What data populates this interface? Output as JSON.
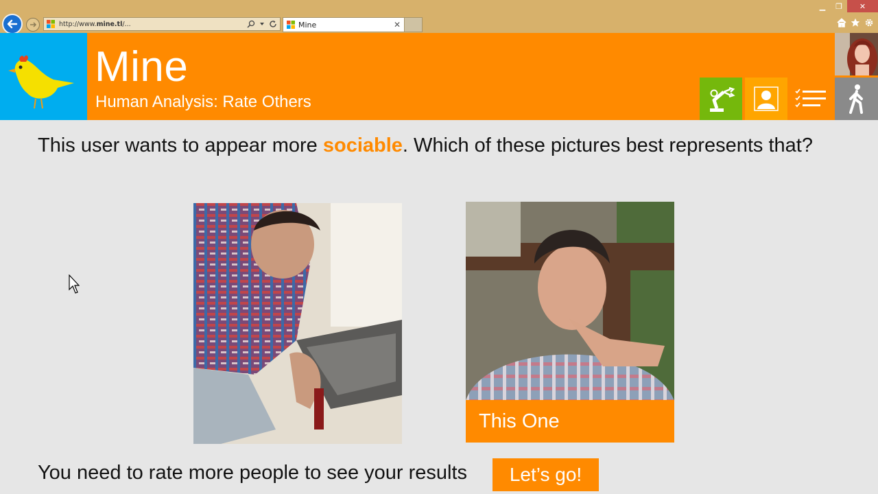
{
  "browser": {
    "url": "http://www.mine.tl/...",
    "url_prefix": "http://www.",
    "url_domain": "mine.tl",
    "url_suffix": "/...",
    "tab_title": "Mine"
  },
  "app": {
    "title": "Mine",
    "subtitle": "Human Analysis: Rate Others"
  },
  "header_tiles": [
    "robot-arm-icon",
    "profile-icon",
    "checklist-icon",
    "walking-person-icon"
  ],
  "question": {
    "prefix": "This user wants to appear more ",
    "keyword": "sociable",
    "suffix": ". Which of these pictures best represents that?"
  },
  "choice": {
    "button_label": "This One"
  },
  "footer": {
    "message": "You need to rate more people to see your results",
    "button_label": "Let’s go!"
  },
  "colors": {
    "accent": "#ff8a00",
    "logo_tile": "#00adef",
    "robot_tile": "#75b80c",
    "profile_tile": "#ffa500",
    "walk_tile": "#8a8a8a",
    "chrome": "#d7b16b"
  }
}
